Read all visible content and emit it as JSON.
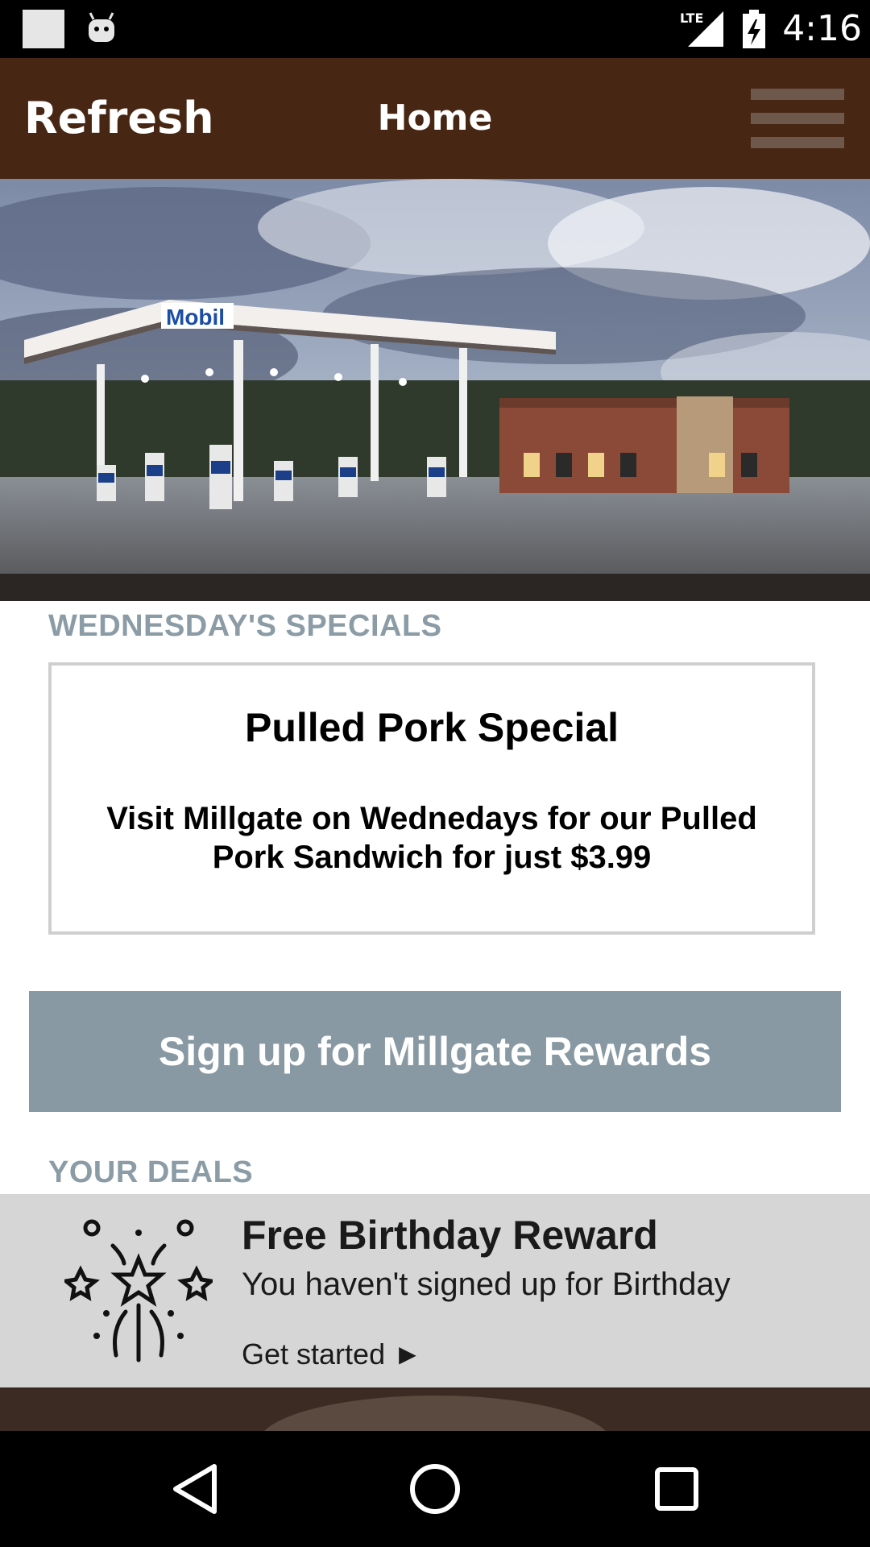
{
  "status_bar": {
    "network": "LTE",
    "time": "4:16",
    "icons": [
      "notification-square-icon",
      "android-debug-icon",
      "lte-signal-icon",
      "battery-charging-icon"
    ]
  },
  "app_bar": {
    "refresh_label": "Refresh",
    "title": "Home",
    "menu_icon": "hamburger-menu-icon",
    "background_color": "#472714"
  },
  "hero": {
    "brand_sign": "Mobil"
  },
  "specials": {
    "section_title": "WEDNESDAY'S SPECIALS",
    "card_title": "Pulled Pork Special",
    "card_description": "Visit Millgate on Wednedays for our Pulled Pork Sandwich for just $3.99"
  },
  "rewards_button": {
    "label": "Sign up for Millgate Rewards",
    "color": "#8999a3"
  },
  "deals": {
    "section_title": "YOUR DEALS",
    "items": [
      {
        "icon": "fireworks-icon",
        "title": "Free Birthday Reward",
        "description": "You haven't signed up for Birthday",
        "cta": "Get started ►"
      }
    ]
  },
  "nav_bar": {
    "icons": [
      "back-triangle-icon",
      "home-circle-icon",
      "recents-square-icon"
    ]
  },
  "colors": {
    "section_title": "#8b9ca6",
    "deal_background": "#d6d6d6"
  }
}
